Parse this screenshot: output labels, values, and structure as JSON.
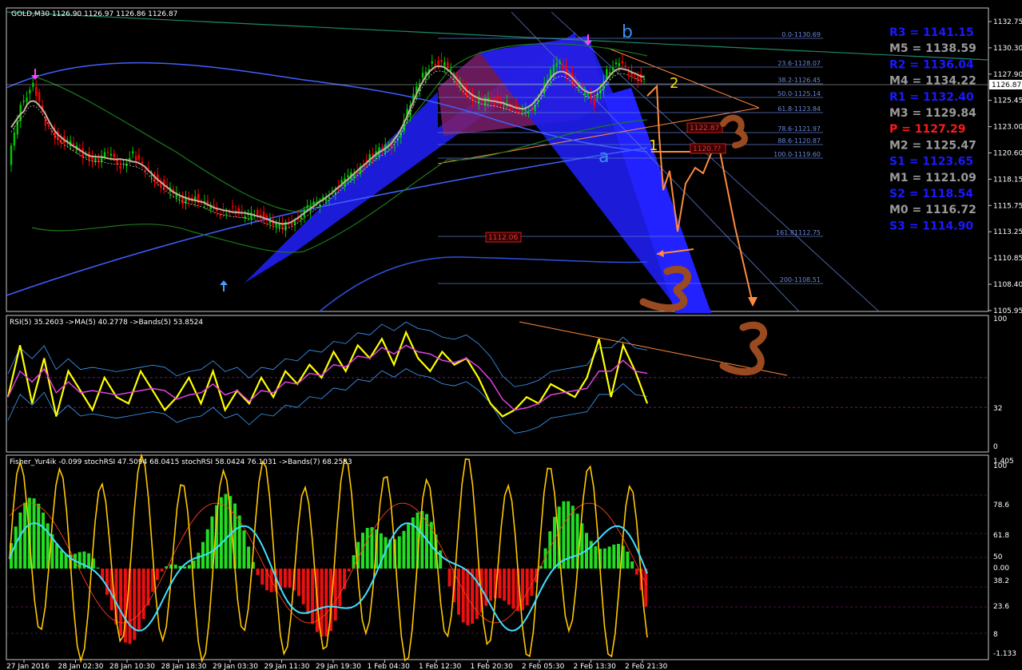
{
  "header": {
    "symbol_line": "GOLD,M30  1126.90 1126.97 1126.86 1126.87",
    "current_price": "1126.87"
  },
  "price_axis": [
    "1132.75",
    "1130.30",
    "1127.90",
    "1125.45",
    "1123.00",
    "1120.60",
    "1118.15",
    "1115.75",
    "1113.25",
    "1110.85",
    "1108.40",
    "1105.95"
  ],
  "time_axis": [
    "27 Jan 2016",
    "28 Jan 02:30",
    "28 Jan 10:30",
    "28 Jan 18:30",
    "29 Jan 03:30",
    "29 Jan 11:30",
    "29 Jan 19:30",
    "1 Feb 04:30",
    "1 Feb 12:30",
    "1 Feb 20:30",
    "2 Feb 05:30",
    "2 Feb 13:30",
    "2 Feb 21:30"
  ],
  "fib_levels": [
    "0.0-1130.69",
    "23.6-1128.07",
    "38.2-1126.45",
    "50.0-1125.14",
    "61.8-1123.84",
    "78.6-1121.97",
    "88.6-1120.87",
    "100.0-1119.60",
    "161.81112.75",
    "200-1108.51"
  ],
  "boxed_labels": [
    "1122.87",
    "1120.??",
    "1112.06"
  ],
  "pivots": [
    {
      "label": "R3 = 1141.15",
      "color": "#1a1aff"
    },
    {
      "label": "M5 = 1138.59",
      "color": "#9a9a9a"
    },
    {
      "label": "R2 = 1136.04",
      "color": "#1a1aff"
    },
    {
      "label": "M4 = 1134.22",
      "color": "#9a9a9a"
    },
    {
      "label": "R1 = 1132.40",
      "color": "#1a1aff"
    },
    {
      "label": "M3 = 1129.84",
      "color": "#9a9a9a"
    },
    {
      "label": "P  = 1127.29",
      "color": "#ff1a1a"
    },
    {
      "label": "M2 = 1125.47",
      "color": "#9a9a9a"
    },
    {
      "label": "S1 = 1123.65",
      "color": "#1a1aff"
    },
    {
      "label": "M1 = 1121.09",
      "color": "#9a9a9a"
    },
    {
      "label": "S2 = 1118.54",
      "color": "#1a1aff"
    },
    {
      "label": "M0 = 1116.72",
      "color": "#9a9a9a"
    },
    {
      "label": "S3 = 1114.90",
      "color": "#1a1aff"
    }
  ],
  "annotations": {
    "wave_b": "b",
    "wave_a": "a",
    "point_1": "1",
    "point_2": "2"
  },
  "rsi_panel": {
    "header": "RSI(5) 35.2603  ->MA(5) 40.2778  ->Bands(5) 53.8524",
    "axis": [
      "100",
      "32",
      "0"
    ]
  },
  "fisher_panel": {
    "header": "Fisher_Yur4ik -0.099  stochRSI 47.5094 68.0415  stochRSI 58.0424 76.1031  ->Bands(7) 68.2583",
    "axis": [
      "1.405",
      "100",
      "78.6",
      "61.8",
      "50",
      "0.00",
      "38.2",
      "23.6",
      "8",
      "-1.133"
    ]
  },
  "colors": {
    "bull": "#00c800",
    "bear": "#ff0000",
    "rsi": "#ffff00",
    "fib": "#5a78c8",
    "orange": "#ff8a3d",
    "blue_wedge": "#1e1ef0",
    "purple_wedge": "#7a1e6a"
  },
  "chart_data": {
    "type": "candlestick",
    "symbol": "GOLD",
    "timeframe": "M30",
    "ylim": [
      1105.0,
      1134.0
    ],
    "x_tick_labels": [
      "27 Jan 2016",
      "28 Jan 02:30",
      "28 Jan 10:30",
      "28 Jan 18:30",
      "29 Jan 03:30",
      "29 Jan 11:30",
      "29 Jan 19:30",
      "1 Feb 04:30",
      "1 Feb 12:30",
      "1 Feb 20:30",
      "2 Feb 05:30",
      "2 Feb 13:30",
      "2 Feb 21:30"
    ],
    "close_path": [
      1119.0,
      1125.0,
      1126.5,
      1123.0,
      1121.5,
      1121.0,
      1120.0,
      1119.5,
      1120.0,
      1119.0,
      1120.0,
      1118.5,
      1117.5,
      1116.5,
      1115.5,
      1116.0,
      1115.0,
      1114.5,
      1114.8,
      1114.0,
      1114.5,
      1113.5,
      1113.0,
      1113.8,
      1114.8,
      1115.5,
      1116.5,
      1117.5,
      1118.5,
      1119.8,
      1120.5,
      1121.0,
      1124.0,
      1127.0,
      1129.0,
      1128.5,
      1127.0,
      1125.5,
      1125.0,
      1125.3,
      1124.8,
      1124.0,
      1124.5,
      1126.5,
      1129.0,
      1127.5,
      1126.0,
      1125.0,
      1128.0,
      1128.6,
      1127.8,
      1126.9
    ],
    "rsi_path": [
      40,
      80,
      35,
      70,
      25,
      60,
      45,
      30,
      55,
      40,
      35,
      60,
      45,
      30,
      40,
      55,
      35,
      60,
      30,
      45,
      35,
      55,
      40,
      60,
      50,
      65,
      55,
      75,
      60,
      80,
      70,
      85,
      65,
      90,
      70,
      60,
      75,
      65,
      70,
      55,
      35,
      25,
      30,
      40,
      35,
      50,
      45,
      40,
      55,
      85,
      40,
      80,
      60,
      35
    ]
  }
}
